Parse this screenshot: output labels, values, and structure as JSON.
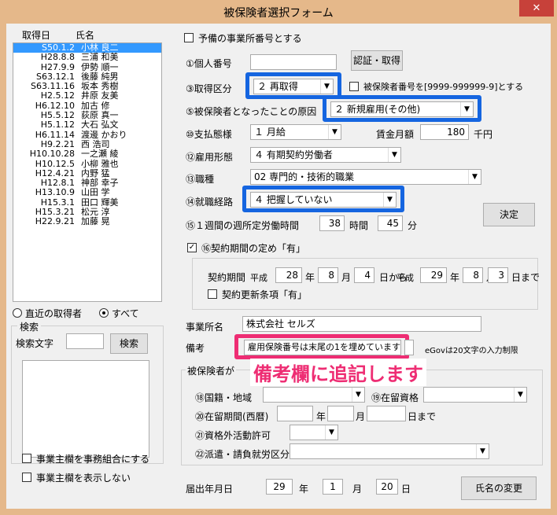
{
  "window": {
    "title": "被保険者選択フォーム",
    "close_label": "✕"
  },
  "list": {
    "col_date": "取得日",
    "col_name": "氏名",
    "rows": [
      {
        "date": "S50.1.2",
        "name": "小林 良二"
      },
      {
        "date": "H28.8.8",
        "name": "三浦 和美"
      },
      {
        "date": "H27.9.9",
        "name": "伊勢 順一"
      },
      {
        "date": "S63.12.1",
        "name": "後藤 純男"
      },
      {
        "date": "S63.11.16",
        "name": "坂本 秀樹"
      },
      {
        "date": "H2.5.12",
        "name": "井原 友美"
      },
      {
        "date": "H6.12.10",
        "name": "加古 修"
      },
      {
        "date": "H5.5.12",
        "name": "荻原 真一"
      },
      {
        "date": "H5.1.12",
        "name": "大石 弘文"
      },
      {
        "date": "H6.11.14",
        "name": "渡邊 かおり"
      },
      {
        "date": "H9.2.21",
        "name": "西 浩司"
      },
      {
        "date": "H10.10.28",
        "name": "一之瀬 綾"
      },
      {
        "date": "H10.12.5",
        "name": "小柳 雅也"
      },
      {
        "date": "H12.4.21",
        "name": "内野 猛"
      },
      {
        "date": "H12.8.1",
        "name": "神部 幸子"
      },
      {
        "date": "H13.10.9",
        "name": "山田 学"
      },
      {
        "date": "H15.3.1",
        "name": "田口 輝美"
      },
      {
        "date": "H15.3.21",
        "name": "松元 淳"
      },
      {
        "date": "H22.9.21",
        "name": "加藤 晃"
      }
    ]
  },
  "filter": {
    "recent_label": "直近の取得者",
    "all_label": "すべて"
  },
  "search": {
    "group_label": "検索",
    "text_label": "検索文字",
    "button_label": "検索",
    "value": ""
  },
  "bottom_checks": {
    "combine_label": "事業主欄を事務組合にする",
    "hide_label": "事業主欄を表示しない"
  },
  "form": {
    "reserve_office_label": "予備の事業所番号とする",
    "personal_no_label": "①個人番号",
    "personal_no_value": "",
    "auth_button": "認証・取得",
    "acq_type_label": "③取得区分",
    "acq_type_value": "２ 再取得",
    "insured_no_check_label": "被保険者番号を[9999-999999-9]とする",
    "cause_label": "⑤被保険者となったことの原因",
    "cause_value": "２ 新規雇用(その他)",
    "pay_form_label": "⑩支払態様",
    "pay_form_value": "１ 月給",
    "wage_label": "賃金月額",
    "wage_value": "180",
    "wage_unit": "千円",
    "employment_label": "⑫雇用形態",
    "employment_value": "４ 有期契約労働者",
    "job_label": "⑬職種",
    "job_value": "02 専門的・技術的職業",
    "route_label": "⑭就職経路",
    "route_value": "４ 把握していない",
    "hours_label": "⑮１週間の週所定労働時間",
    "hours_value": "38",
    "hours_unit": "時間",
    "minutes_value": "45",
    "minutes_unit": "分",
    "decide_button": "決定",
    "contract_check_label": "⑯契約期間の定め「有」",
    "contract_period_label": "契約期間",
    "era1": "平成",
    "from_y": "28",
    "y1": "年",
    "from_m": "8",
    "m1": "月",
    "from_d": "4",
    "from_suffix": "日から",
    "era2": "平成",
    "to_y": "29",
    "y2": "年",
    "to_m": "8",
    "m2": "月",
    "to_d": "3",
    "to_suffix": "日まで",
    "renewal_label": "契約更新条項「有」",
    "office_label": "事業所名",
    "office_value": "株式会社 セルズ",
    "remarks_label": "備考",
    "remarks_value": "雇用保険番号は末尾の1を埋めています",
    "remarks_value2": "",
    "egov_note": "eGovは20文字の入力制限",
    "annotation": "備考欄に追記します",
    "insured_group_label": "被保険者が",
    "nationality_label": "⑱国籍・地域",
    "residence_label": "⑲在留資格",
    "period_label": "⑳在留期間(西暦)",
    "year_unit": "年",
    "month_unit": "月",
    "until_label": "日まで",
    "permit_label": "㉑資格外活動許可",
    "dispatch_label": "㉒派遣・請負就労区分",
    "filing_label": "届出年月日",
    "filing_y": "29",
    "filing_y_unit": "年",
    "filing_m": "1",
    "filing_m_unit": "月",
    "filing_d": "20",
    "filing_d_unit": "日",
    "rename_button": "氏名の変更"
  },
  "colors": {
    "accent_blue": "#1565e0",
    "accent_pink": "#ee2d73",
    "selection": "#3399ff",
    "title_bar": "#e5b88a"
  }
}
